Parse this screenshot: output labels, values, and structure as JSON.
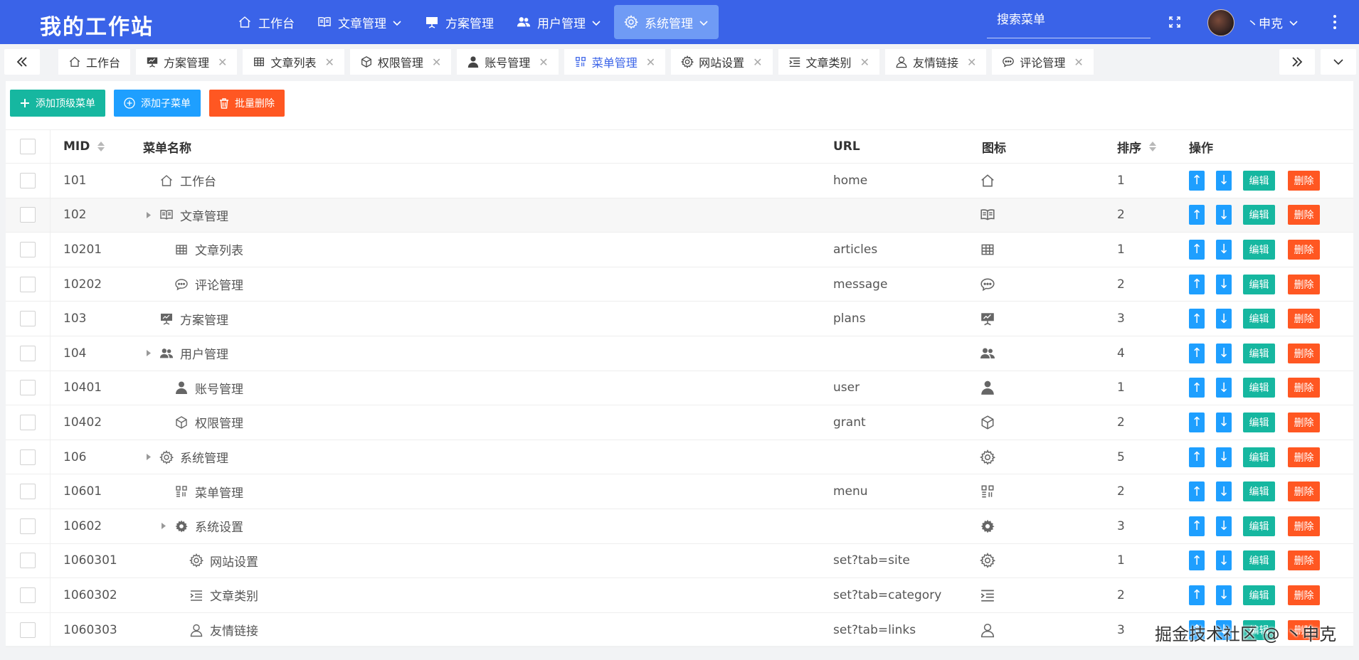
{
  "header": {
    "logo": "我的工作站",
    "nav": [
      {
        "label": "工作台",
        "icon": "home-icon",
        "caret": false,
        "active": false
      },
      {
        "label": "文章管理",
        "icon": "book-icon",
        "caret": true,
        "active": false
      },
      {
        "label": "方案管理",
        "icon": "presentation-icon",
        "caret": false,
        "active": false
      },
      {
        "label": "用户管理",
        "icon": "users-icon",
        "caret": true,
        "active": false
      },
      {
        "label": "系统管理",
        "icon": "gear-icon",
        "caret": true,
        "active": true
      }
    ],
    "search_placeholder": "搜索菜单",
    "username": "丶申克"
  },
  "tabs": [
    {
      "label": "工作台",
      "icon": "home-icon",
      "closable": false,
      "active": false
    },
    {
      "label": "方案管理",
      "icon": "presentation-icon",
      "closable": true,
      "active": false
    },
    {
      "label": "文章列表",
      "icon": "table-icon",
      "closable": true,
      "active": false
    },
    {
      "label": "权限管理",
      "icon": "cube-icon",
      "closable": true,
      "active": false
    },
    {
      "label": "账号管理",
      "icon": "user-icon",
      "closable": true,
      "active": false
    },
    {
      "label": "菜单管理",
      "icon": "grid-menu-icon",
      "closable": true,
      "active": true
    },
    {
      "label": "网站设置",
      "icon": "gear-outline-icon",
      "closable": true,
      "active": false
    },
    {
      "label": "文章类别",
      "icon": "list-indent-icon",
      "closable": true,
      "active": false
    },
    {
      "label": "友情链接",
      "icon": "user-outline-icon",
      "closable": true,
      "active": false
    },
    {
      "label": "评论管理",
      "icon": "comment-icon",
      "closable": true,
      "active": false
    }
  ],
  "toolbar": {
    "add_top": "添加顶级菜单",
    "add_child": "添加子菜单",
    "batch_delete": "批量删除"
  },
  "table": {
    "columns": {
      "mid": "MID",
      "name": "菜单名称",
      "url": "URL",
      "icon": "图标",
      "sort": "排序",
      "ops": "操作"
    },
    "rows": [
      {
        "mid": "101",
        "name": "工作台",
        "url": "home",
        "icon": "home-icon",
        "sort": "1",
        "level": 0,
        "expandable": false
      },
      {
        "mid": "102",
        "name": "文章管理",
        "url": "",
        "icon": "book-icon",
        "sort": "2",
        "level": 0,
        "expandable": true
      },
      {
        "mid": "10201",
        "name": "文章列表",
        "url": "articles",
        "icon": "table-icon",
        "sort": "1",
        "level": 1,
        "expandable": false
      },
      {
        "mid": "10202",
        "name": "评论管理",
        "url": "message",
        "icon": "comment-icon",
        "sort": "2",
        "level": 1,
        "expandable": false
      },
      {
        "mid": "103",
        "name": "方案管理",
        "url": "plans",
        "icon": "presentation-icon",
        "sort": "3",
        "level": 0,
        "expandable": false
      },
      {
        "mid": "104",
        "name": "用户管理",
        "url": "",
        "icon": "users-icon",
        "sort": "4",
        "level": 0,
        "expandable": true
      },
      {
        "mid": "10401",
        "name": "账号管理",
        "url": "user",
        "icon": "user-icon",
        "sort": "1",
        "level": 1,
        "expandable": false
      },
      {
        "mid": "10402",
        "name": "权限管理",
        "url": "grant",
        "icon": "cube-icon",
        "sort": "2",
        "level": 1,
        "expandable": false
      },
      {
        "mid": "106",
        "name": "系统管理",
        "url": "",
        "icon": "gear-outline-icon",
        "sort": "5",
        "level": 0,
        "expandable": true
      },
      {
        "mid": "10601",
        "name": "菜单管理",
        "url": "menu",
        "icon": "grid-menu-icon",
        "sort": "2",
        "level": 1,
        "expandable": false
      },
      {
        "mid": "10602",
        "name": "系统设置",
        "url": "",
        "icon": "gear-solid-icon",
        "sort": "3",
        "level": 1,
        "expandable": true
      },
      {
        "mid": "1060301",
        "name": "网站设置",
        "url": "set?tab=site",
        "icon": "gear-outline-icon",
        "sort": "1",
        "level": 2,
        "expandable": false
      },
      {
        "mid": "1060302",
        "name": "文章类别",
        "url": "set?tab=category",
        "icon": "list-indent-icon",
        "sort": "2",
        "level": 2,
        "expandable": false
      },
      {
        "mid": "1060303",
        "name": "友情链接",
        "url": "set?tab=links",
        "icon": "user-outline-icon",
        "sort": "3",
        "level": 2,
        "expandable": false
      }
    ],
    "ops": {
      "up": "↑",
      "down": "↓",
      "edit": "编辑",
      "delete": "删除"
    }
  },
  "watermark": "掘金技术社区 @ 丶申克",
  "colors": {
    "header": "#3a63e8",
    "active_nav": "#6f9bf5",
    "green": "#16b7a0",
    "blue": "#1e9fff",
    "orange": "#ff5722"
  }
}
